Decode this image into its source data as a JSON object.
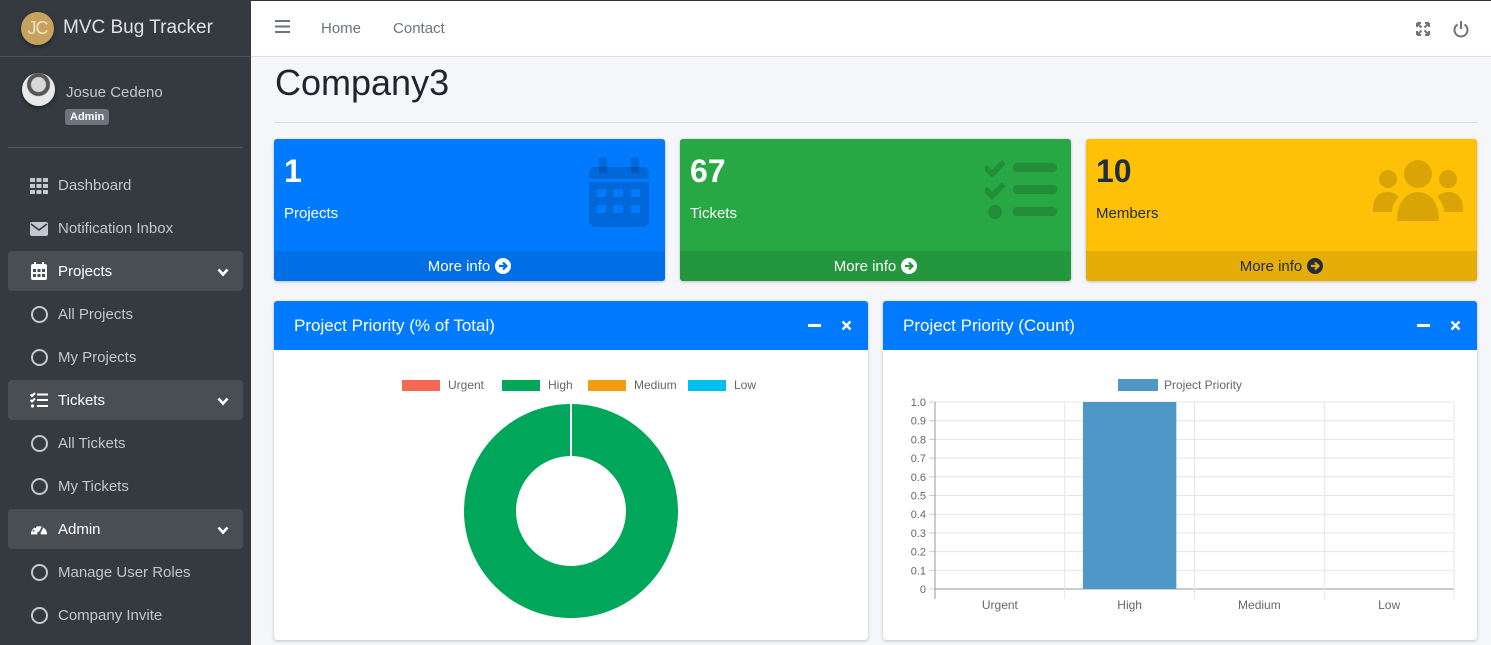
{
  "brand": {
    "logo_text": "JC",
    "title": "MVC Bug Tracker"
  },
  "user": {
    "name": "Josue Cedeno",
    "role": "Admin"
  },
  "sidebar": {
    "items": [
      {
        "label": "Dashboard",
        "icon": "grid-icon"
      },
      {
        "label": "Notification Inbox",
        "icon": "envelope-icon"
      },
      {
        "label": "Projects",
        "icon": "calendar-icon",
        "open": true
      },
      {
        "label": "All Projects",
        "icon": "circle-icon"
      },
      {
        "label": "My Projects",
        "icon": "circle-icon"
      },
      {
        "label": "Tickets",
        "icon": "tasks-icon",
        "open": true
      },
      {
        "label": "All Tickets",
        "icon": "circle-icon"
      },
      {
        "label": "My Tickets",
        "icon": "circle-icon"
      },
      {
        "label": "Admin",
        "icon": "gauge-icon",
        "open": true
      },
      {
        "label": "Manage User Roles",
        "icon": "circle-icon"
      },
      {
        "label": "Company Invite",
        "icon": "circle-icon"
      }
    ]
  },
  "topbar": {
    "links": [
      "Home",
      "Contact"
    ]
  },
  "page": {
    "title": "Company3"
  },
  "stats": [
    {
      "value": "1",
      "label": "Projects",
      "link": "More info",
      "color": "#007bff",
      "icon": "calendar-icon"
    },
    {
      "value": "67",
      "label": "Tickets",
      "link": "More info",
      "color": "#28a745",
      "icon": "tasks-icon"
    },
    {
      "value": "10",
      "label": "Members",
      "link": "More info",
      "color": "#ffc107",
      "icon": "users-icon"
    }
  ],
  "cards": {
    "pie_title": "Project Priority (% of Total)",
    "bar_title": "Project Priority (Count)"
  },
  "chart_data": [
    {
      "type": "pie",
      "categories": [
        "Urgent",
        "High",
        "Medium",
        "Low"
      ],
      "values": [
        0,
        100,
        0,
        0
      ],
      "colors": [
        "#f56954",
        "#00a65a",
        "#f39c12",
        "#00c0ef"
      ],
      "legend": "top"
    },
    {
      "type": "bar",
      "categories": [
        "Urgent",
        "High",
        "Medium",
        "Low"
      ],
      "series": [
        {
          "name": "Project Priority",
          "values": [
            0,
            1,
            0,
            0
          ]
        }
      ],
      "color": "#4f97c6",
      "ylim": [
        0,
        1.0
      ],
      "yticks": [
        "0",
        "0.1",
        "0.2",
        "0.3",
        "0.4",
        "0.5",
        "0.6",
        "0.7",
        "0.8",
        "0.9",
        "1.0"
      ],
      "grid": true,
      "legend": "top"
    }
  ]
}
